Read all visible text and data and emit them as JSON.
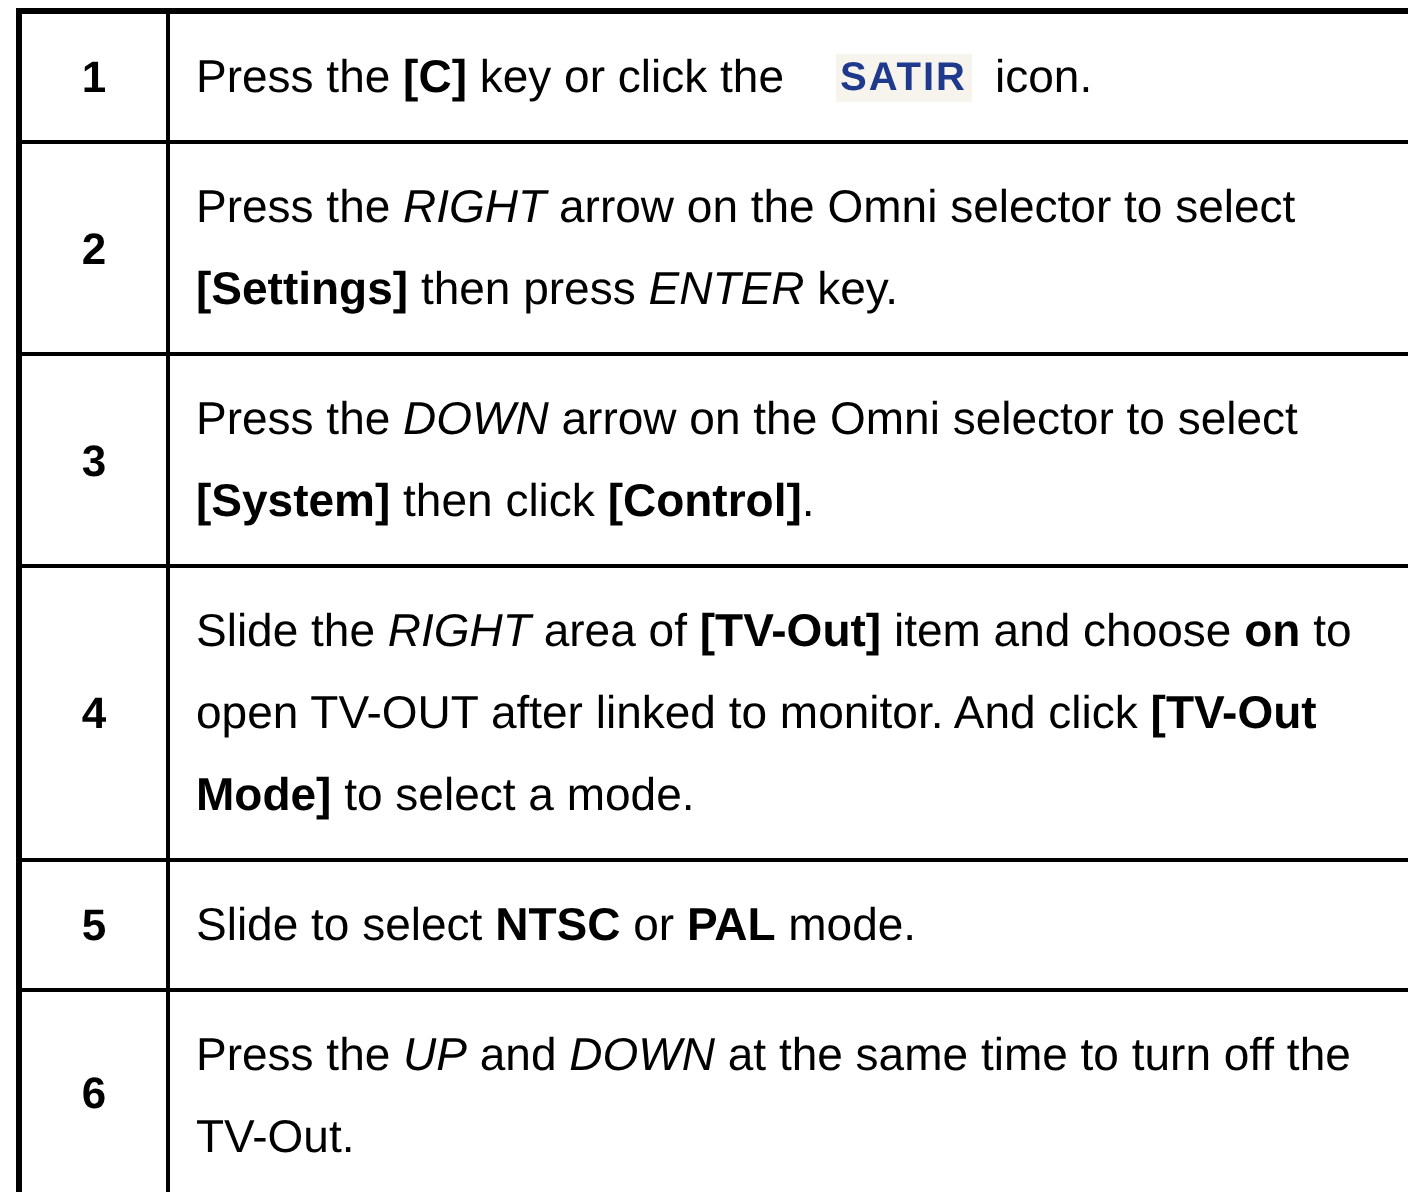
{
  "steps": [
    {
      "number": "1",
      "text": "Press the **[C]** key or click the",
      "logo": "SATIR",
      "text_after": "icon."
    },
    {
      "number": "2",
      "text": "Press the *RIGHT* arrow on the Omni selector to select **[Settings]** then press *ENTER* key."
    },
    {
      "number": "3",
      "text": "Press the *DOWN* arrow on the Omni selector to select **[System]** then click **[Control]**."
    },
    {
      "number": "4",
      "text": "Slide the *RIGHT* area of **[TV-Out]** item and choose **on** to open TV-OUT after linked to monitor. And click **[TV-Out Mode]** to select a mode."
    },
    {
      "number": "5",
      "text": "Slide to select **NTSC** or **PAL** mode."
    },
    {
      "number": "6",
      "text": "Press the *UP* and *DOWN* at the same time to turn off the TV-Out."
    }
  ]
}
